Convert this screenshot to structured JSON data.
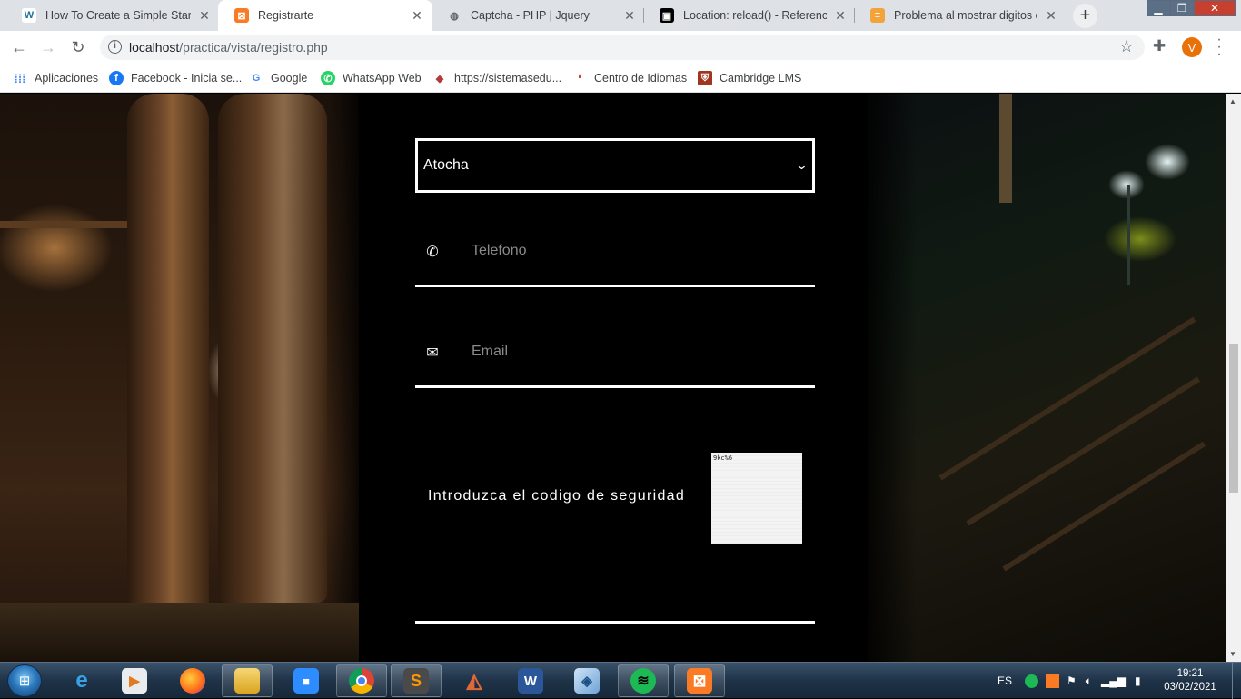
{
  "browser": {
    "tabs": [
      {
        "title": "How To Create a Simple Star Ra",
        "icon": "w-icon",
        "active": false
      },
      {
        "title": "Registrarte",
        "icon": "xampp-icon",
        "active": true
      },
      {
        "title": "Captcha - PHP | Jquery",
        "icon": "globe-icon",
        "active": false
      },
      {
        "title": "Location: reload() - Referencia d",
        "icon": "mdn-icon",
        "active": false
      },
      {
        "title": "Problema al mostrar digitos de",
        "icon": "stackoverflow-es-icon",
        "active": false
      }
    ],
    "close_glyph": "✕",
    "new_tab_glyph": "+",
    "url_host": "localhost",
    "url_path": "/practica/vista/registro.php",
    "profile_initial": "V",
    "bookmarks": [
      {
        "label": "Aplicaciones",
        "icon": "apps-grid-icon"
      },
      {
        "label": "Facebook - Inicia se...",
        "icon": "facebook-icon"
      },
      {
        "label": "Google",
        "icon": "google-icon"
      },
      {
        "label": "WhatsApp Web",
        "icon": "whatsapp-icon"
      },
      {
        "label": "https://sistemasedu...",
        "icon": "site-icon"
      },
      {
        "label": "Centro de Idiomas",
        "icon": "idiomas-icon"
      },
      {
        "label": "Cambridge LMS",
        "icon": "cambridge-icon"
      }
    ]
  },
  "form": {
    "select_value": "Atocha",
    "phone_placeholder": "Telefono",
    "email_placeholder": "Email",
    "captcha_label": "Introduzca el codigo de seguridad",
    "captcha_text": "9kc%6"
  },
  "taskbar": {
    "apps": [
      "internet-explorer",
      "media-player",
      "firefox",
      "file-explorer",
      "zoom",
      "chrome",
      "sublime-text",
      "matlab",
      "word",
      "virtualbox",
      "spotify",
      "xampp"
    ],
    "language": "ES",
    "time": "19:21",
    "date": "03/02/2021"
  },
  "colors": {
    "accent_orange": "#e8710a",
    "taskbar": "#1f3348",
    "form_bg": "#000000",
    "form_fg": "#ffffff"
  }
}
